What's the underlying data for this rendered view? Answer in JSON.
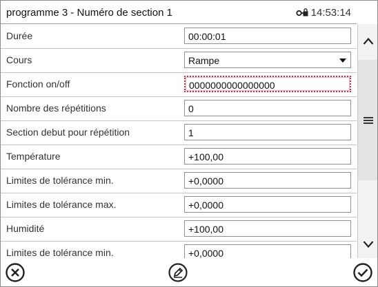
{
  "header": {
    "title": "programme 3 - Numéro de section 1",
    "time": "14:53:14",
    "lock_icon": "key-lock-icon"
  },
  "rows": [
    {
      "label": "Durée",
      "value": "00:00:01",
      "type": "text"
    },
    {
      "label": "Cours",
      "value": "Rampe",
      "type": "select"
    },
    {
      "label": "Fonction on/off",
      "value": "0000000000000000",
      "type": "error"
    },
    {
      "label": "Nombre des répétitions",
      "value": "0",
      "type": "text"
    },
    {
      "label": "Section debut pour répétition",
      "value": "1",
      "type": "text"
    },
    {
      "label": "Température",
      "value": "+100,00",
      "type": "text"
    },
    {
      "label": "Limites de tolérance min.",
      "value": "+0,0000",
      "type": "text"
    },
    {
      "label": "Limites de tolérance max.",
      "value": "+0,0000",
      "type": "text"
    },
    {
      "label": "Humidité",
      "value": "+100,00",
      "type": "text"
    },
    {
      "label": "Limites de tolérance min.",
      "value": "+0,0000",
      "type": "text"
    }
  ],
  "scrollbar": {
    "up_icon": "chevron-up-icon",
    "handle_icon": "hamburger-icon",
    "down_icon": "chevron-down-icon"
  },
  "footer": {
    "cancel_icon": "cancel-circle-icon",
    "edit_icon": "edit-pencil-icon",
    "confirm_icon": "confirm-check-icon"
  },
  "colors": {
    "error_border": "#d9263a",
    "border": "#8e8e8e",
    "scrollbar_bg": "#f2f2f2"
  }
}
